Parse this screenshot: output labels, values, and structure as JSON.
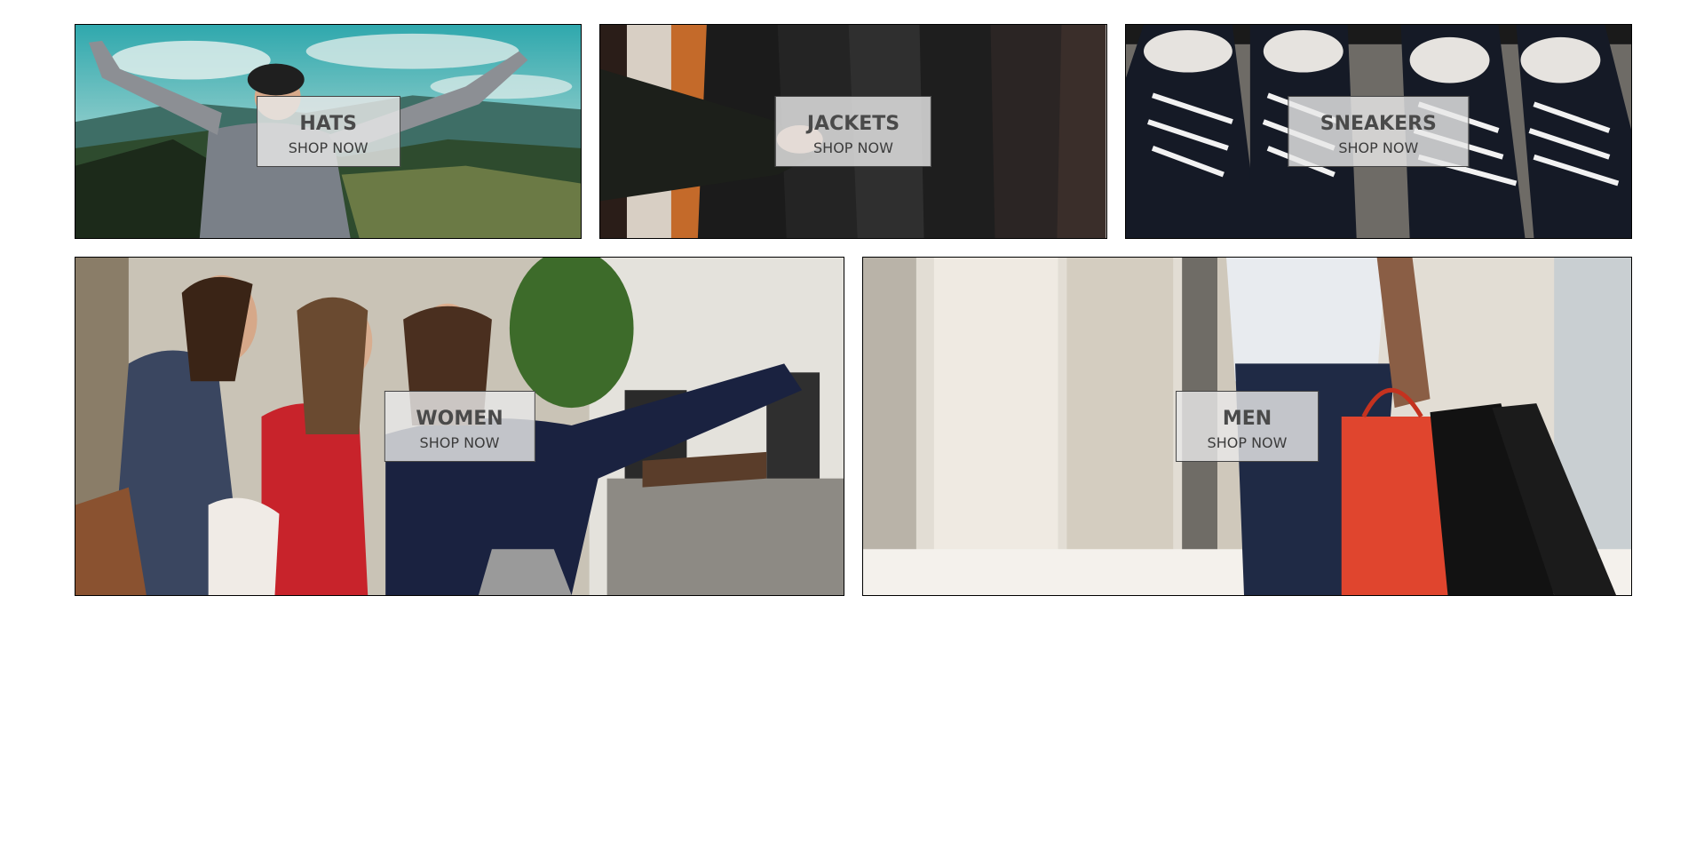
{
  "directory": {
    "categories": [
      {
        "title": "HATS",
        "subtitle": "SHOP NOW",
        "image": "man-arms-raised-mountain-view"
      },
      {
        "title": "JACKETS",
        "subtitle": "SHOP NOW",
        "image": "leather-jackets-on-rack"
      },
      {
        "title": "SNEAKERS",
        "subtitle": "SHOP NOW",
        "image": "black-canvas-sneakers"
      },
      {
        "title": "WOMEN",
        "subtitle": "SHOP NOW",
        "image": "women-taking-selfie-street"
      },
      {
        "title": "MEN",
        "subtitle": "SHOP NOW",
        "image": "man-holding-shopping-bags"
      }
    ]
  }
}
